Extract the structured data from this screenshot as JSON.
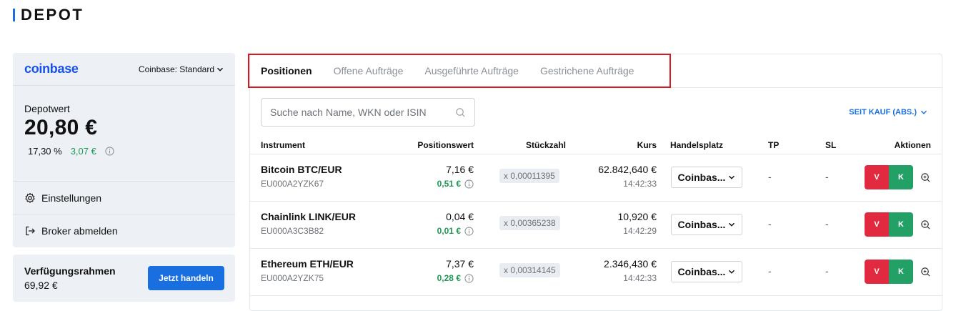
{
  "page": {
    "title": "DEPOT"
  },
  "broker": {
    "logo": "coinbase",
    "account": "Coinbase: Standard",
    "depot_label": "Depotwert",
    "depot_value": "20,80 €",
    "perf_percent": "17,30 %",
    "perf_abs": "3,07 €",
    "menu": [
      {
        "label": "Einstellungen",
        "icon": "gear-icon"
      },
      {
        "label": "Broker abmelden",
        "icon": "logout-icon"
      }
    ]
  },
  "funds": {
    "label": "Verfügungsrahmen",
    "value": "69,92 €",
    "button": "Jetzt handeln"
  },
  "tabs": [
    {
      "label": "Positionen",
      "active": true
    },
    {
      "label": "Offene Aufträge",
      "active": false
    },
    {
      "label": "Ausgeführte Aufträge",
      "active": false
    },
    {
      "label": "Gestrichene Aufträge",
      "active": false
    }
  ],
  "search": {
    "placeholder": "Suche nach Name, WKN oder ISIN"
  },
  "sort": {
    "label": "SEIT KAUF (ABS.)"
  },
  "table": {
    "headers": {
      "instrument": "Instrument",
      "position_value": "Positionswert",
      "quantity": "Stückzahl",
      "price": "Kurs",
      "venue": "Handelsplatz",
      "tp": "TP",
      "sl": "SL",
      "actions": "Aktionen"
    },
    "sell_label": "V",
    "buy_label": "K",
    "rows": [
      {
        "name": "Bitcoin BTC/EUR",
        "isin": "EU000A2YZK67",
        "value": "7,16 €",
        "gain": "0,51 €",
        "qty": "x 0,00011395",
        "price": "62.842,640 €",
        "time": "14:42:33",
        "venue": "Coinbas...",
        "tp": "-",
        "sl": "-"
      },
      {
        "name": "Chainlink LINK/EUR",
        "isin": "EU000A3C3B82",
        "value": "0,04 €",
        "gain": "0,01 €",
        "qty": "x 0,00365238",
        "price": "10,920 €",
        "time": "14:42:29",
        "venue": "Coinbas...",
        "tp": "-",
        "sl": "-"
      },
      {
        "name": "Ethereum ETH/EUR",
        "isin": "EU000A2YZK75",
        "value": "7,37 €",
        "gain": "0,28 €",
        "qty": "x 0,00314145",
        "price": "2.346,430 €",
        "time": "14:42:33",
        "venue": "Coinbas...",
        "tp": "-",
        "sl": "-"
      }
    ]
  },
  "colors": {
    "accent": "#1a6fe0",
    "gain": "#1d9b56",
    "sell": "#e12a3f",
    "buy": "#22a065",
    "highlight": "#d9191f"
  }
}
